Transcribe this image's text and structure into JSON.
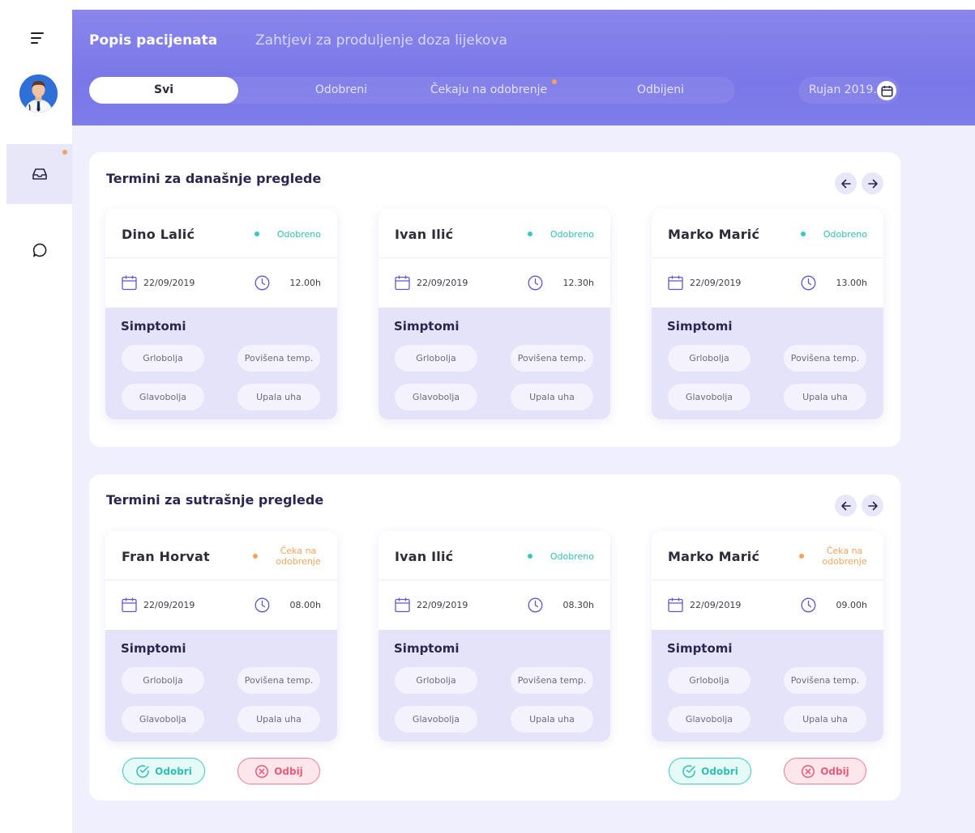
{
  "sidebar": {
    "menu_icon": "menu-icon",
    "avatar": "doctor-avatar",
    "items": [
      {
        "icon": "inbox-icon",
        "active": true,
        "badge": true
      },
      {
        "icon": "chat-icon",
        "active": false,
        "badge": false
      }
    ]
  },
  "header": {
    "tabs": [
      "Popis pacijenata",
      "Zahtjevi za produljenje doza lijekova"
    ],
    "filters": [
      "Svi",
      "Odobreni",
      "Čekaju na odobrenje",
      "Odbijeni"
    ],
    "active_filter": "Svi",
    "date_label": "Rujan 2019."
  },
  "colors": {
    "header": "#7f7cea",
    "approved": "#35c9c0",
    "pending": "#f5a35c",
    "reject": "#ea5b7a",
    "symptom_bg": "#e5e3fa"
  },
  "sections": [
    {
      "title": "Termini za današnje preglede",
      "cards": [
        {
          "name": "Dino Lalić",
          "status": "Odobreno",
          "status_type": "approved",
          "date": "22/09/2019",
          "time": "12.00h",
          "symptoms_title": "Simptomi",
          "symptoms": [
            "Grlobolja",
            "Povišena temp.",
            "Glavobolja",
            "Upala uha"
          ]
        },
        {
          "name": "Ivan Ilić",
          "status": "Odobreno",
          "status_type": "approved",
          "date": "22/09/2019",
          "time": "12.30h",
          "symptoms_title": "Simptomi",
          "symptoms": [
            "Grlobolja",
            "Povišena temp.",
            "Glavobolja",
            "Upala uha"
          ]
        },
        {
          "name": "Marko Marić",
          "status": "Odobreno",
          "status_type": "approved",
          "date": "22/09/2019",
          "time": "13.00h",
          "symptoms_title": "Simptomi",
          "symptoms": [
            "Grlobolja",
            "Povišena temp.",
            "Glavobolja",
            "Upala uha"
          ]
        }
      ]
    },
    {
      "title": "Termini za sutrašnje preglede",
      "cards": [
        {
          "name": "Fran Horvat",
          "status": "Čeka na odobrenje",
          "status_type": "pending",
          "date": "22/09/2019",
          "time": "08.00h",
          "symptoms_title": "Simptomi",
          "symptoms": [
            "Grlobolja",
            "Povišena temp.",
            "Glavobolja",
            "Upala uha"
          ],
          "actions": [
            "Odobri",
            "Odbij"
          ]
        },
        {
          "name": "Ivan Ilić",
          "status": "Odobreno",
          "status_type": "approved",
          "date": "22/09/2019",
          "time": "08.30h",
          "symptoms_title": "Simptomi",
          "symptoms": [
            "Grlobolja",
            "Povišena temp.",
            "Glavobolja",
            "Upala uha"
          ]
        },
        {
          "name": "Marko Marić",
          "status": "Čeka na odobrenje",
          "status_type": "pending",
          "date": "22/09/2019",
          "time": "09.00h",
          "symptoms_title": "Simptomi",
          "symptoms": [
            "Grlobolja",
            "Povišena temp.",
            "Glavobolja",
            "Upala uha"
          ],
          "actions": [
            "Odobri",
            "Odbij"
          ]
        }
      ]
    }
  ]
}
